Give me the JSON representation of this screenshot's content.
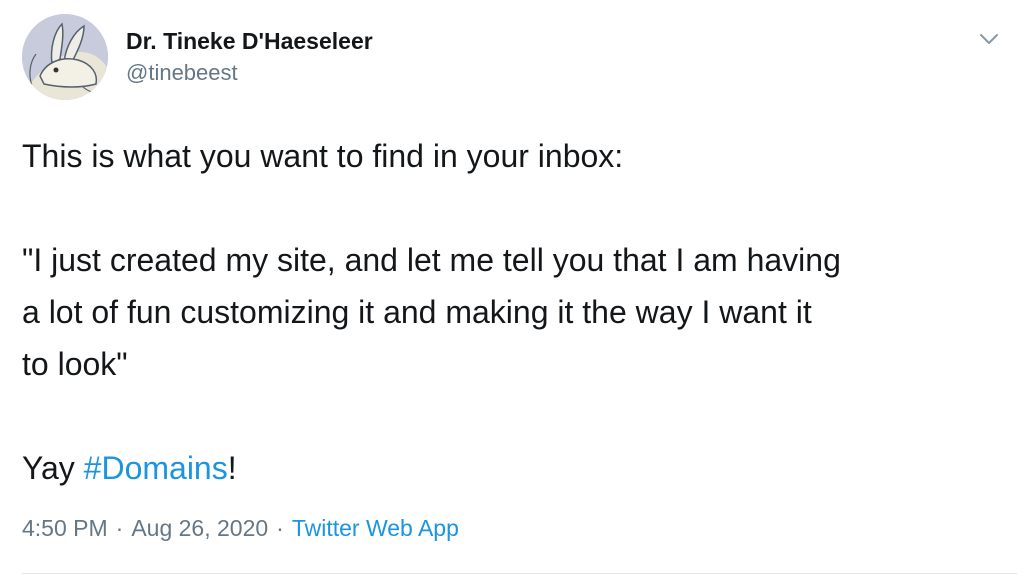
{
  "author": {
    "display_name": "Dr. Tineke D'Haeseleer",
    "handle": "@tinebeest",
    "avatar_icon": "rabbit-drawing-avatar"
  },
  "tweet": {
    "line1": "This is what you want to find in your inbox:",
    "line2": "\"I just created my site, and let me tell you that I am having",
    "line3": "a lot of fun customizing it and making it the way I want it",
    "line4": "to look\"",
    "yay_prefix": "Yay ",
    "hashtag": "#Domains",
    "yay_suffix": "!"
  },
  "meta": {
    "time": "4:50 PM",
    "separator": "·",
    "date": "Aug 26, 2020",
    "source": "Twitter Web App"
  },
  "colors": {
    "link": "#1b95e0",
    "secondary_text": "#657786",
    "primary_text": "#14171a",
    "divider": "#e1e8ed"
  },
  "icons": {
    "menu": "chevron-down-icon"
  }
}
